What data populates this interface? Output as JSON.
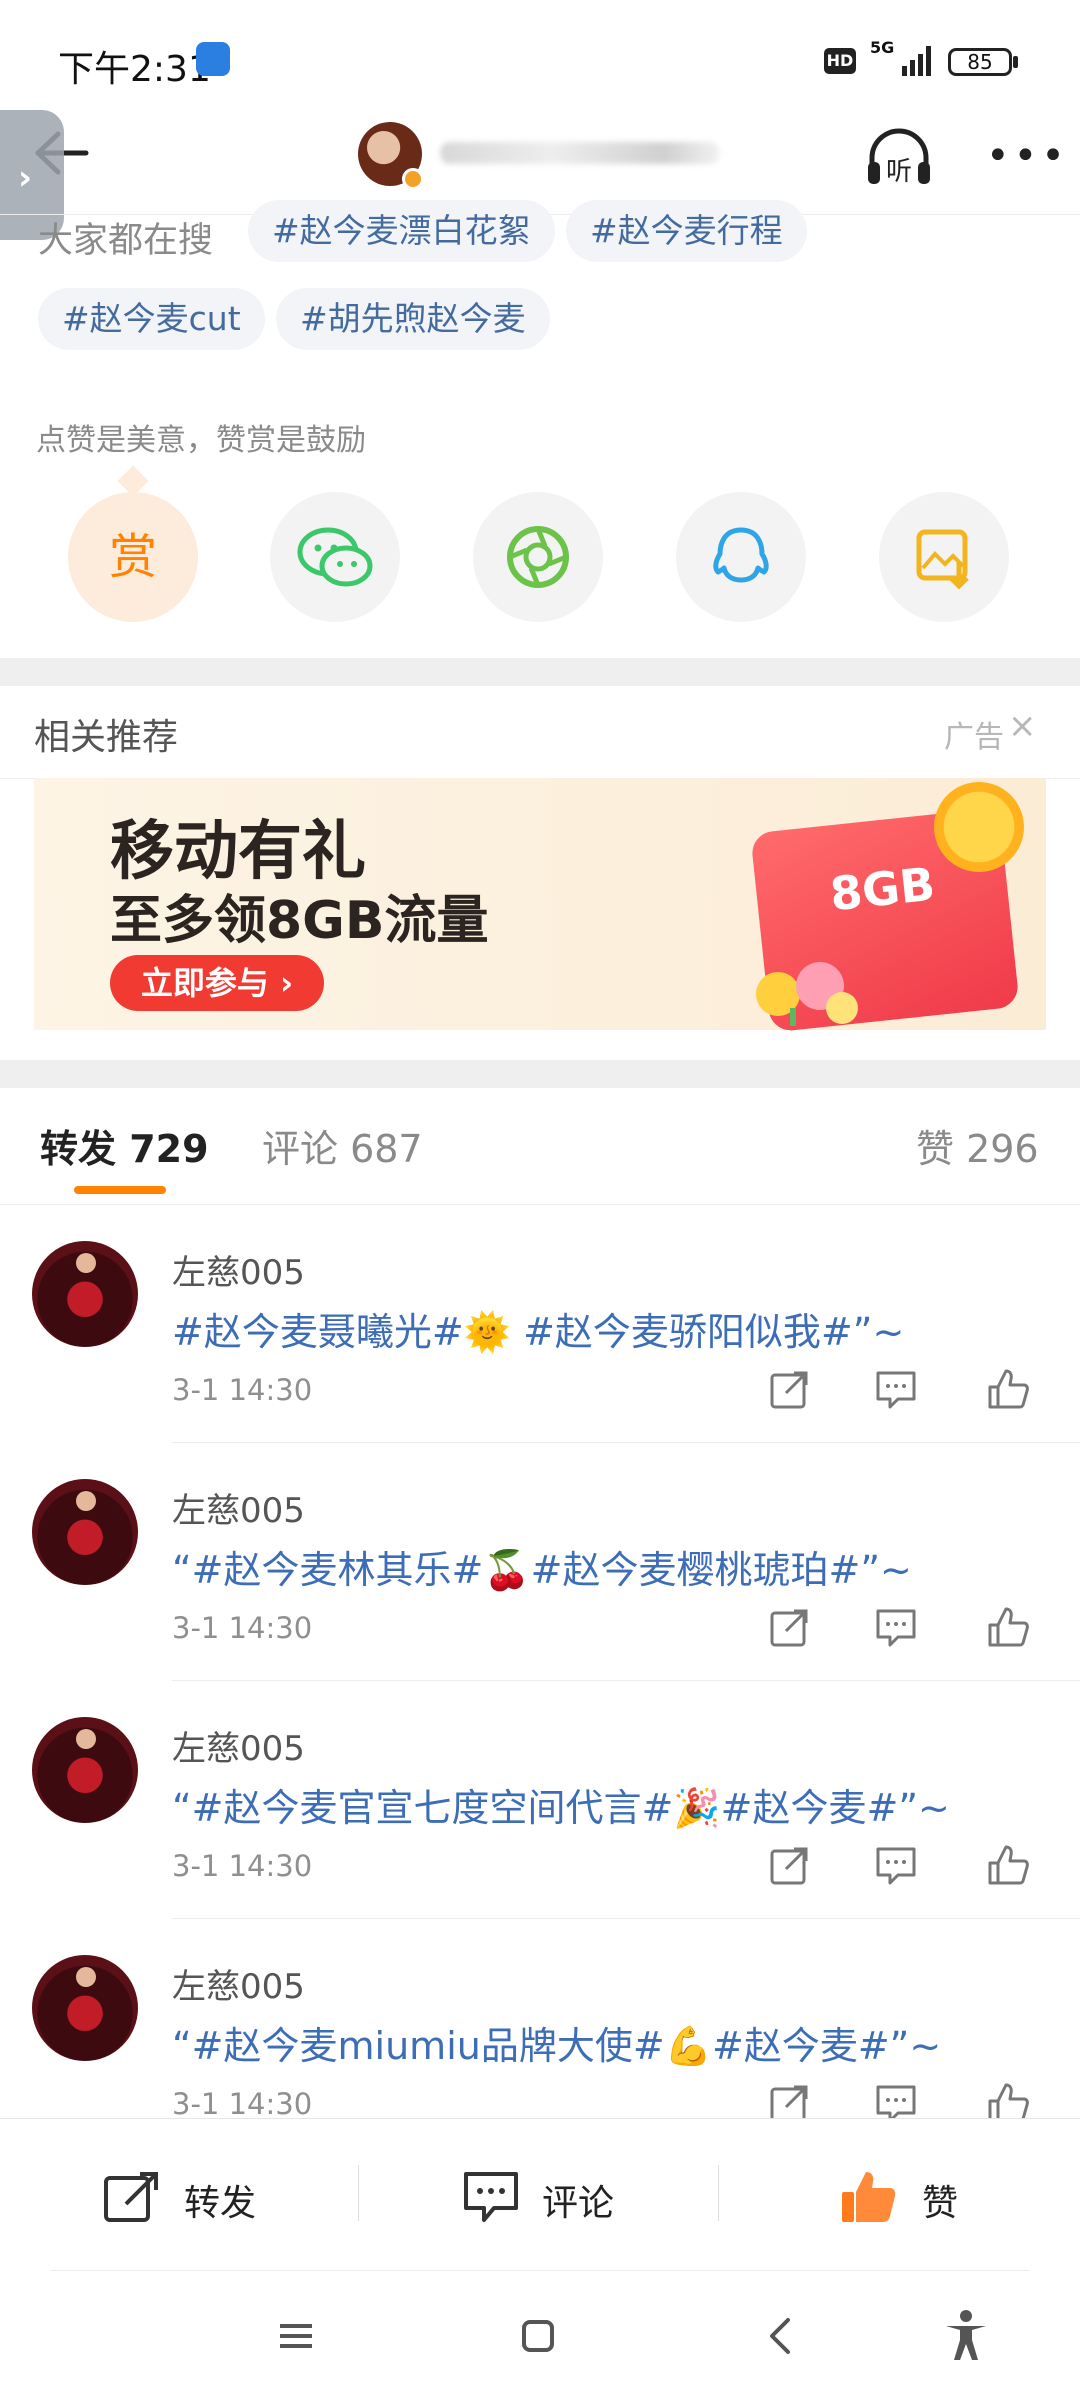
{
  "status_bar": {
    "time": "下午2:31",
    "hd": "HD",
    "network": "5G",
    "battery": "85"
  },
  "nav": {
    "listen_label": "听",
    "more_label": "•••"
  },
  "search_tags": {
    "label": "大家都在搜",
    "tags": [
      "#赵今麦漂白花絮",
      "#赵今麦行程",
      "#赵今麦cut",
      "#胡先煦赵今麦"
    ]
  },
  "praise_text": "点赞是美意，赞赏是鼓励",
  "share": {
    "reward_label": "赏",
    "targets": [
      "wechat-icon",
      "moments-icon",
      "qq-icon",
      "save-image-icon"
    ]
  },
  "related": {
    "title": "相关推荐",
    "ad_label": "广告",
    "banner_title": "移动有礼",
    "banner_subtitle": "至多领8GB流量",
    "banner_cta": "立即参与 ›",
    "coupon_text": "8GB"
  },
  "tabs": {
    "repost": "转发 729",
    "comment": "评论 687",
    "like": "赞 296"
  },
  "reposts": [
    {
      "user": "左慈005",
      "text": "#赵今麦聂曦光#🌞 #赵今麦骄阳似我#”~",
      "time": "3-1 14:30"
    },
    {
      "user": "左慈005",
      "text": "“#赵今麦林其乐#🍒#赵今麦樱桃琥珀#”~",
      "time": "3-1 14:30"
    },
    {
      "user": "左慈005",
      "text": "“#赵今麦官宣七度空间代言#🎉#赵今麦#”~",
      "time": "3-1 14:30"
    },
    {
      "user": "左慈005",
      "text": "“#赵今麦miumiu品牌大使#💪#赵今麦#”~",
      "time": "3-1 14:30"
    }
  ],
  "bottom_bar": {
    "repost": "转发",
    "comment": "评论",
    "like": "赞"
  },
  "colors": {
    "accent": "#ff8200",
    "link": "#3d6db6",
    "tag_text": "#436b9e"
  }
}
